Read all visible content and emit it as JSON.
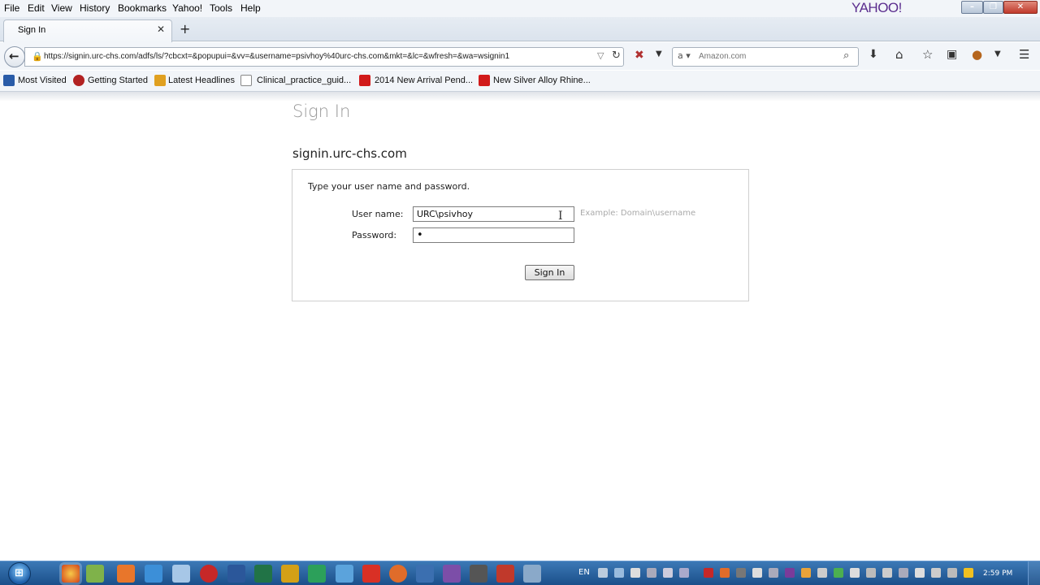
{
  "menubar": {
    "items": [
      "File",
      "Edit",
      "View",
      "History",
      "Bookmarks",
      "Yahoo!",
      "Tools",
      "Help"
    ],
    "brand": "YAHOO!"
  },
  "tab": {
    "title": "Sign In",
    "close_icon": "close-icon",
    "new_tab_icon": "plus-icon"
  },
  "navbar": {
    "url": "https://signin.urc-chs.com/adfs/ls/?cbcxt=&popupui=&vv=&username=psivhoy%40urc-chs.com&mkt=&lc=&wfresh=&wa=wsignin1",
    "search_engine": "Amazon",
    "search_placeholder": "Amazon.com"
  },
  "bookmarks": [
    {
      "label": "Most Visited",
      "color": "#2a5ca8"
    },
    {
      "label": "Getting Started",
      "color": "#b22222"
    },
    {
      "label": "Latest Headlines",
      "color": "#e0a020"
    },
    {
      "label": "Clinical_practice_guid...",
      "color": "#ffffff"
    },
    {
      "label": "2014 New Arrival Pend...",
      "color": "#d11a1a"
    },
    {
      "label": "New Silver Alloy Rhine...",
      "color": "#d11a1a"
    }
  ],
  "page": {
    "title": "Sign In",
    "site": "signin.urc-chs.com",
    "instruction": "Type your user name and password.",
    "username_label": "User name:",
    "username_value": "URC\\psivhoy",
    "username_hint": "Example: Domain\\username",
    "password_label": "Password:",
    "password_value": "•",
    "signin_label": "Sign In"
  },
  "taskbar": {
    "lang": "EN",
    "time": "2:59 PM"
  }
}
